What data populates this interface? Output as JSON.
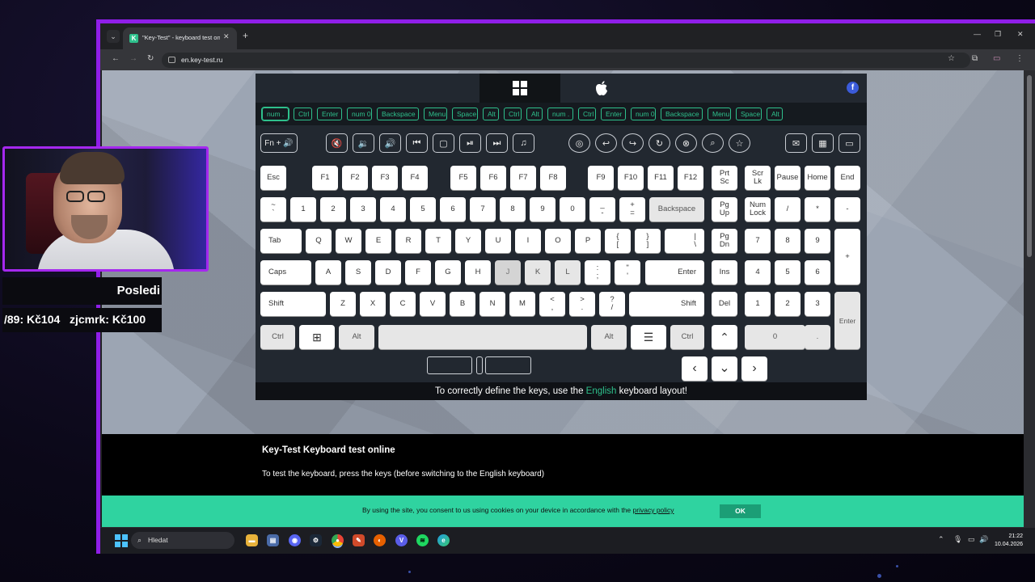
{
  "browser": {
    "tab_title": "\"Key-Test\" - keyboard test online",
    "favicon_letter": "K",
    "url": "en.key-test.ru"
  },
  "keyboard": {
    "os_tabs": [
      "windows-icon",
      "apple-icon"
    ],
    "log_keys": [
      "num .",
      "Ctrl",
      "Enter",
      "num 0",
      "Backspace",
      "Menu",
      "Space",
      "Alt",
      "Ctrl",
      "Alt",
      "num .",
      "Ctrl",
      "Enter",
      "num 0",
      "Backspace",
      "Menu",
      "Space",
      "Alt"
    ],
    "media_fn_label": "Fn + 🔊",
    "media_icons": [
      "mute-icon",
      "volume-down-icon",
      "volume-up-icon",
      "previous-track-icon",
      "stop-icon",
      "play-pause-icon",
      "next-track-icon",
      "music-icon",
      "browser-icon",
      "back-icon",
      "forward-icon",
      "refresh-icon",
      "stop-page-icon",
      "search-icon",
      "favorites-icon",
      "mail-icon",
      "calculator-icon",
      "my-computer-icon"
    ],
    "media_glyphs": [
      "🔇",
      "🔉",
      "🔊",
      "⏮",
      "▢",
      "⏯",
      "⏭",
      "♫",
      "◎",
      "↩",
      "↪",
      "↻",
      "⊗",
      "⌕",
      "☆",
      "✉",
      "▦",
      "▭"
    ],
    "notice_before": "To correctly define the keys, use the ",
    "notice_green": "English",
    "notice_after": " keyboard layout!"
  },
  "content": {
    "title": "Key-Test Keyboard test online",
    "text": "To test the keyboard, press the keys (before switching to the English keyboard)"
  },
  "cookie": {
    "text": "By using the site, you consent to us using cookies on your device in accordance with the ",
    "link": "privacy policy",
    "ok": "OK"
  },
  "taskbar": {
    "search_placeholder": "Hledat",
    "apps": [
      "file-explorer-icon",
      "task-manager-icon",
      "discord-icon",
      "steam-icon",
      "chrome-icon",
      "paint-icon",
      "firefox-icon",
      "vpn-icon",
      "spotify-icon",
      "edge-icon"
    ],
    "time": "21:22",
    "date": "10.04.2026"
  },
  "overlay": {
    "ticker_label": "Posledi",
    "ticker_text": "/89: Kč104   zjcmrk: Kč100"
  },
  "colors": {
    "accent_green": "#2ec08c",
    "frame_purple": "#8f1ee8",
    "cookie_bar": "#2fd3a0"
  }
}
